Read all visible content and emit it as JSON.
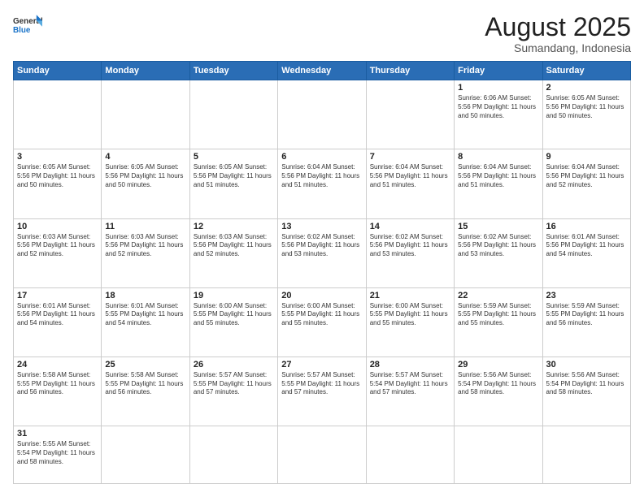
{
  "header": {
    "logo_general": "General",
    "logo_blue": "Blue",
    "month_title": "August 2025",
    "location": "Sumandang, Indonesia"
  },
  "weekdays": [
    "Sunday",
    "Monday",
    "Tuesday",
    "Wednesday",
    "Thursday",
    "Friday",
    "Saturday"
  ],
  "weeks": [
    [
      {
        "day": "",
        "info": ""
      },
      {
        "day": "",
        "info": ""
      },
      {
        "day": "",
        "info": ""
      },
      {
        "day": "",
        "info": ""
      },
      {
        "day": "",
        "info": ""
      },
      {
        "day": "1",
        "info": "Sunrise: 6:06 AM\nSunset: 5:56 PM\nDaylight: 11 hours\nand 50 minutes."
      },
      {
        "day": "2",
        "info": "Sunrise: 6:05 AM\nSunset: 5:56 PM\nDaylight: 11 hours\nand 50 minutes."
      }
    ],
    [
      {
        "day": "3",
        "info": "Sunrise: 6:05 AM\nSunset: 5:56 PM\nDaylight: 11 hours\nand 50 minutes."
      },
      {
        "day": "4",
        "info": "Sunrise: 6:05 AM\nSunset: 5:56 PM\nDaylight: 11 hours\nand 50 minutes."
      },
      {
        "day": "5",
        "info": "Sunrise: 6:05 AM\nSunset: 5:56 PM\nDaylight: 11 hours\nand 51 minutes."
      },
      {
        "day": "6",
        "info": "Sunrise: 6:04 AM\nSunset: 5:56 PM\nDaylight: 11 hours\nand 51 minutes."
      },
      {
        "day": "7",
        "info": "Sunrise: 6:04 AM\nSunset: 5:56 PM\nDaylight: 11 hours\nand 51 minutes."
      },
      {
        "day": "8",
        "info": "Sunrise: 6:04 AM\nSunset: 5:56 PM\nDaylight: 11 hours\nand 51 minutes."
      },
      {
        "day": "9",
        "info": "Sunrise: 6:04 AM\nSunset: 5:56 PM\nDaylight: 11 hours\nand 52 minutes."
      }
    ],
    [
      {
        "day": "10",
        "info": "Sunrise: 6:03 AM\nSunset: 5:56 PM\nDaylight: 11 hours\nand 52 minutes."
      },
      {
        "day": "11",
        "info": "Sunrise: 6:03 AM\nSunset: 5:56 PM\nDaylight: 11 hours\nand 52 minutes."
      },
      {
        "day": "12",
        "info": "Sunrise: 6:03 AM\nSunset: 5:56 PM\nDaylight: 11 hours\nand 52 minutes."
      },
      {
        "day": "13",
        "info": "Sunrise: 6:02 AM\nSunset: 5:56 PM\nDaylight: 11 hours\nand 53 minutes."
      },
      {
        "day": "14",
        "info": "Sunrise: 6:02 AM\nSunset: 5:56 PM\nDaylight: 11 hours\nand 53 minutes."
      },
      {
        "day": "15",
        "info": "Sunrise: 6:02 AM\nSunset: 5:56 PM\nDaylight: 11 hours\nand 53 minutes."
      },
      {
        "day": "16",
        "info": "Sunrise: 6:01 AM\nSunset: 5:56 PM\nDaylight: 11 hours\nand 54 minutes."
      }
    ],
    [
      {
        "day": "17",
        "info": "Sunrise: 6:01 AM\nSunset: 5:56 PM\nDaylight: 11 hours\nand 54 minutes."
      },
      {
        "day": "18",
        "info": "Sunrise: 6:01 AM\nSunset: 5:55 PM\nDaylight: 11 hours\nand 54 minutes."
      },
      {
        "day": "19",
        "info": "Sunrise: 6:00 AM\nSunset: 5:55 PM\nDaylight: 11 hours\nand 55 minutes."
      },
      {
        "day": "20",
        "info": "Sunrise: 6:00 AM\nSunset: 5:55 PM\nDaylight: 11 hours\nand 55 minutes."
      },
      {
        "day": "21",
        "info": "Sunrise: 6:00 AM\nSunset: 5:55 PM\nDaylight: 11 hours\nand 55 minutes."
      },
      {
        "day": "22",
        "info": "Sunrise: 5:59 AM\nSunset: 5:55 PM\nDaylight: 11 hours\nand 55 minutes."
      },
      {
        "day": "23",
        "info": "Sunrise: 5:59 AM\nSunset: 5:55 PM\nDaylight: 11 hours\nand 56 minutes."
      }
    ],
    [
      {
        "day": "24",
        "info": "Sunrise: 5:58 AM\nSunset: 5:55 PM\nDaylight: 11 hours\nand 56 minutes."
      },
      {
        "day": "25",
        "info": "Sunrise: 5:58 AM\nSunset: 5:55 PM\nDaylight: 11 hours\nand 56 minutes."
      },
      {
        "day": "26",
        "info": "Sunrise: 5:57 AM\nSunset: 5:55 PM\nDaylight: 11 hours\nand 57 minutes."
      },
      {
        "day": "27",
        "info": "Sunrise: 5:57 AM\nSunset: 5:55 PM\nDaylight: 11 hours\nand 57 minutes."
      },
      {
        "day": "28",
        "info": "Sunrise: 5:57 AM\nSunset: 5:54 PM\nDaylight: 11 hours\nand 57 minutes."
      },
      {
        "day": "29",
        "info": "Sunrise: 5:56 AM\nSunset: 5:54 PM\nDaylight: 11 hours\nand 58 minutes."
      },
      {
        "day": "30",
        "info": "Sunrise: 5:56 AM\nSunset: 5:54 PM\nDaylight: 11 hours\nand 58 minutes."
      }
    ],
    [
      {
        "day": "31",
        "info": "Sunrise: 5:55 AM\nSunset: 5:54 PM\nDaylight: 11 hours\nand 58 minutes."
      },
      {
        "day": "",
        "info": ""
      },
      {
        "day": "",
        "info": ""
      },
      {
        "day": "",
        "info": ""
      },
      {
        "day": "",
        "info": ""
      },
      {
        "day": "",
        "info": ""
      },
      {
        "day": "",
        "info": ""
      }
    ]
  ]
}
